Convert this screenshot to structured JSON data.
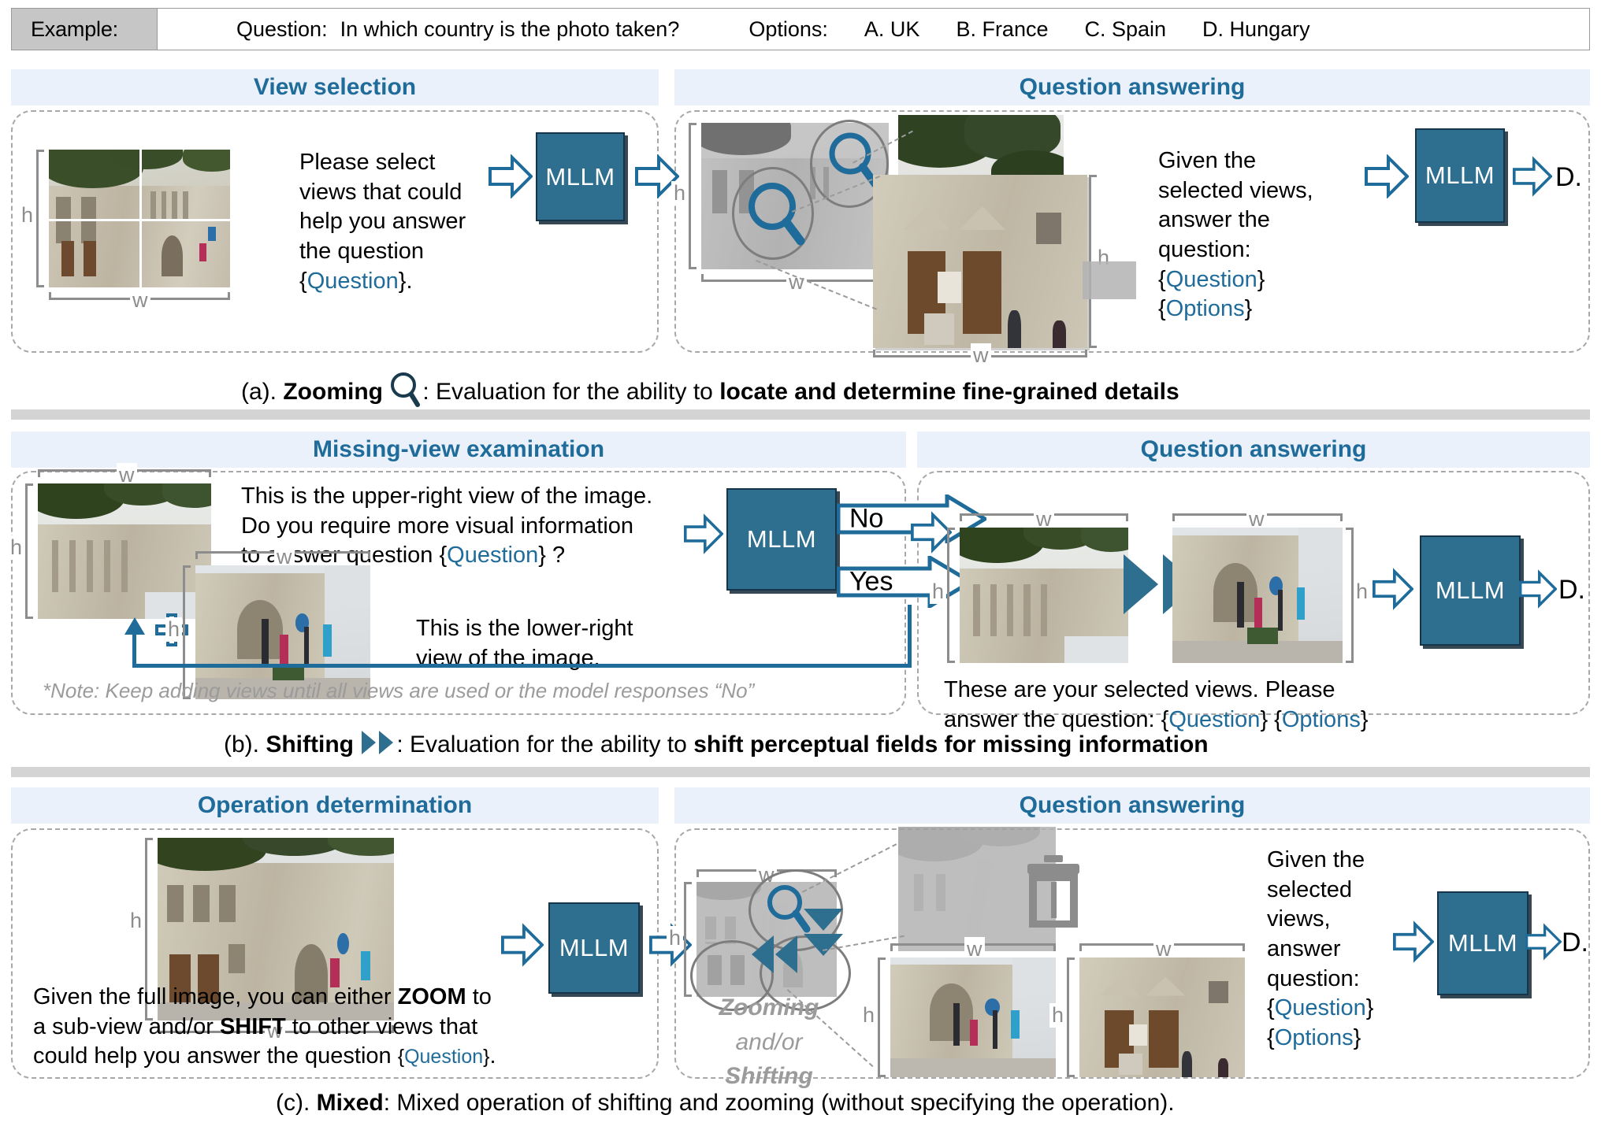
{
  "example": {
    "label": "Example:",
    "question_label": "Question:",
    "question_text": "In which country is the photo taken?",
    "options_label": "Options:",
    "options": [
      "A. UK",
      "B. France",
      "C. Spain",
      "D. Hungary"
    ]
  },
  "colors": {
    "accent_blue": "#1F6B9A",
    "mllm_box": "#2E6E8E",
    "header_bar": "#eaf1fa",
    "band_gray": "#d4d4d4",
    "muted_gray": "#9b9b9b"
  },
  "rows": [
    {
      "id": "zooming",
      "left_header": "View selection",
      "right_header": "Question answering",
      "left_prompt_lines": [
        "Please select",
        "views that could",
        "help you answer",
        "the question",
        "{Question}."
      ],
      "right_prompt_lines": [
        "Given the",
        "selected views,",
        "answer the",
        "question:",
        "{Question}",
        "{Options}"
      ],
      "model_label": "MLLM",
      "answer": "D.",
      "caption_prefix": "(a). ",
      "caption_bold": "Zooming",
      "caption_icon": "magnifier-icon",
      "caption_mid": ": Evaluation for the ability to ",
      "caption_bold_tail": "locate and determine fine-grained details"
    },
    {
      "id": "shifting",
      "left_header": "Missing-view examination",
      "right_header": "Question answering",
      "left_prompt_lines": [
        "This is the upper-right view of the image.",
        "Do you require more visual information",
        "to answer question {Question} ?"
      ],
      "second_prompt_lines": [
        "This is the lower-right",
        "view of the image."
      ],
      "branch_no": "No",
      "branch_yes": "Yes",
      "note": "*Note: Keep adding views until all views are used or the model responses “No”",
      "right_prompt_lines": [
        "These are your selected views. Please",
        "answer the question: {Question} {Options}"
      ],
      "model_label": "MLLM",
      "answer": "D.",
      "caption_prefix": "(b). ",
      "caption_bold": "Shifting",
      "caption_icon": "double-chevron-right-icon",
      "caption_mid": ": Evaluation for the ability to ",
      "caption_bold_tail": "shift perceptual fields for missing information"
    },
    {
      "id": "mixed",
      "left_header": "Operation determination",
      "right_header": "Question answering",
      "left_prompt_lines": [
        "Given the full image, you can either ZOOM to",
        "a sub-view and/or SHIFT to other views that",
        "could help you answer the question {Question}."
      ],
      "ops_label_lines": [
        "Zooming",
        "and/or",
        "Shifting"
      ],
      "right_prompt_lines": [
        "Given the",
        "selected",
        "views,",
        "answer",
        "question:",
        "{Question}",
        "{Options}"
      ],
      "model_label": "MLLM",
      "answer": "D.",
      "caption_prefix": "(c). ",
      "caption_bold": "Mixed",
      "caption_icon": "none",
      "caption_mid": ": Mixed operation of shifting and zooming (without specifying the operation).",
      "caption_bold_tail": ""
    }
  ],
  "dimension_labels": {
    "height": "h",
    "width": "w"
  },
  "icons": {
    "magnifier": "magnifier-icon",
    "trash": "trash-icon",
    "plus": "plus-icon",
    "shift_right": "double-triangle-right-icon",
    "shift_left": "double-triangle-left-icon",
    "shift_down": "double-triangle-down-icon",
    "block_arrow_right": "block-arrow-right-icon"
  }
}
